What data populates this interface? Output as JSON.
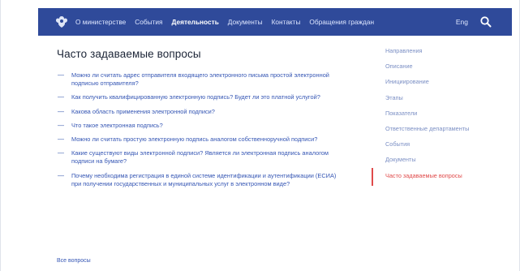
{
  "nav": {
    "items": [
      {
        "label": "О министерстве",
        "active": false
      },
      {
        "label": "События",
        "active": false
      },
      {
        "label": "Деятельность",
        "active": true
      },
      {
        "label": "Документы",
        "active": false
      },
      {
        "label": "Контакты",
        "active": false
      },
      {
        "label": "Обращения граждан",
        "active": false
      }
    ],
    "lang": "Eng",
    "search_icon": "search-icon",
    "emblem_icon": "coat-of-arms-icon",
    "bg_color": "#2f4a9a"
  },
  "main": {
    "title": "Часто задаваемые вопросы",
    "questions": [
      "Можно ли считать адрес отправителя входящего электронного письма простой электронной подписью отправителя?",
      "Как получить квалифицированную электронную подпись? Будет ли это платной услугой?",
      "Какова область применения электронной подписи?",
      "Что такое электронная подпись?",
      "Можно ли считать простую электронную подпись аналогом собственноручной подписи?",
      "Какие существуют виды электронной подписи? Является ли электронная подпись аналогом подписи на бумаге?",
      "Почему необходима регистрация в единой системе идентификации и аутентификации (ЕСИА) при получении государственных и муниципальных услуг в электронном виде?"
    ],
    "all_link": "Все вопросы"
  },
  "side_nav": {
    "items": [
      {
        "label": "Направления",
        "active": false
      },
      {
        "label": "Описание",
        "active": false
      },
      {
        "label": "Инициирование",
        "active": false
      },
      {
        "label": "Этапы",
        "active": false
      },
      {
        "label": "Показатели",
        "active": false
      },
      {
        "label": "Ответственные департаменты",
        "active": false
      },
      {
        "label": "События",
        "active": false
      },
      {
        "label": "Документы",
        "active": false
      },
      {
        "label": "Часто задаваемые вопросы",
        "active": true
      }
    ],
    "active_color": "#e04a4a"
  }
}
